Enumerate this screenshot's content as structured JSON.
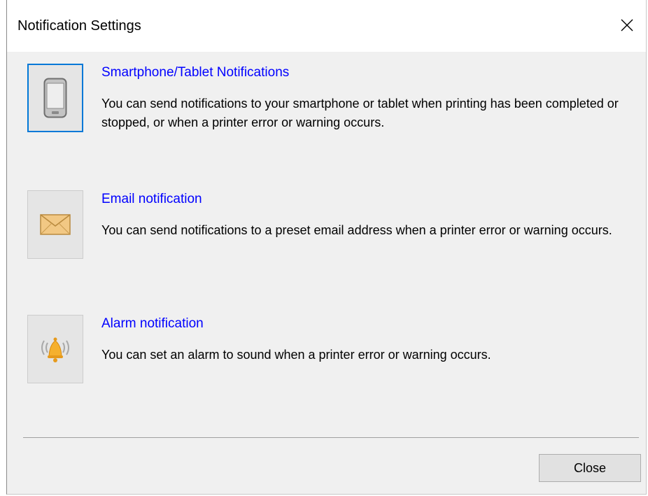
{
  "window": {
    "title": "Notification Settings"
  },
  "items": [
    {
      "label": "Smartphone/Tablet Notifications",
      "description": "You can send notifications to your smartphone or tablet when printing has been completed or stopped, or when a printer error or warning occurs.",
      "icon": "smartphone-icon",
      "selected": true
    },
    {
      "label": "Email notification",
      "description": "You can send notifications to a preset email address when a printer error or warning occurs.",
      "icon": "envelope-icon",
      "selected": false
    },
    {
      "label": "Alarm notification",
      "description": "You can set an alarm to sound when a printer error or warning occurs.",
      "icon": "alarm-bell-icon",
      "selected": false
    }
  ],
  "footer": {
    "close_label": "Close"
  },
  "colors": {
    "link": "#0000ff",
    "selection_border": "#0078d7",
    "dialog_background": "#f0f0f0"
  }
}
